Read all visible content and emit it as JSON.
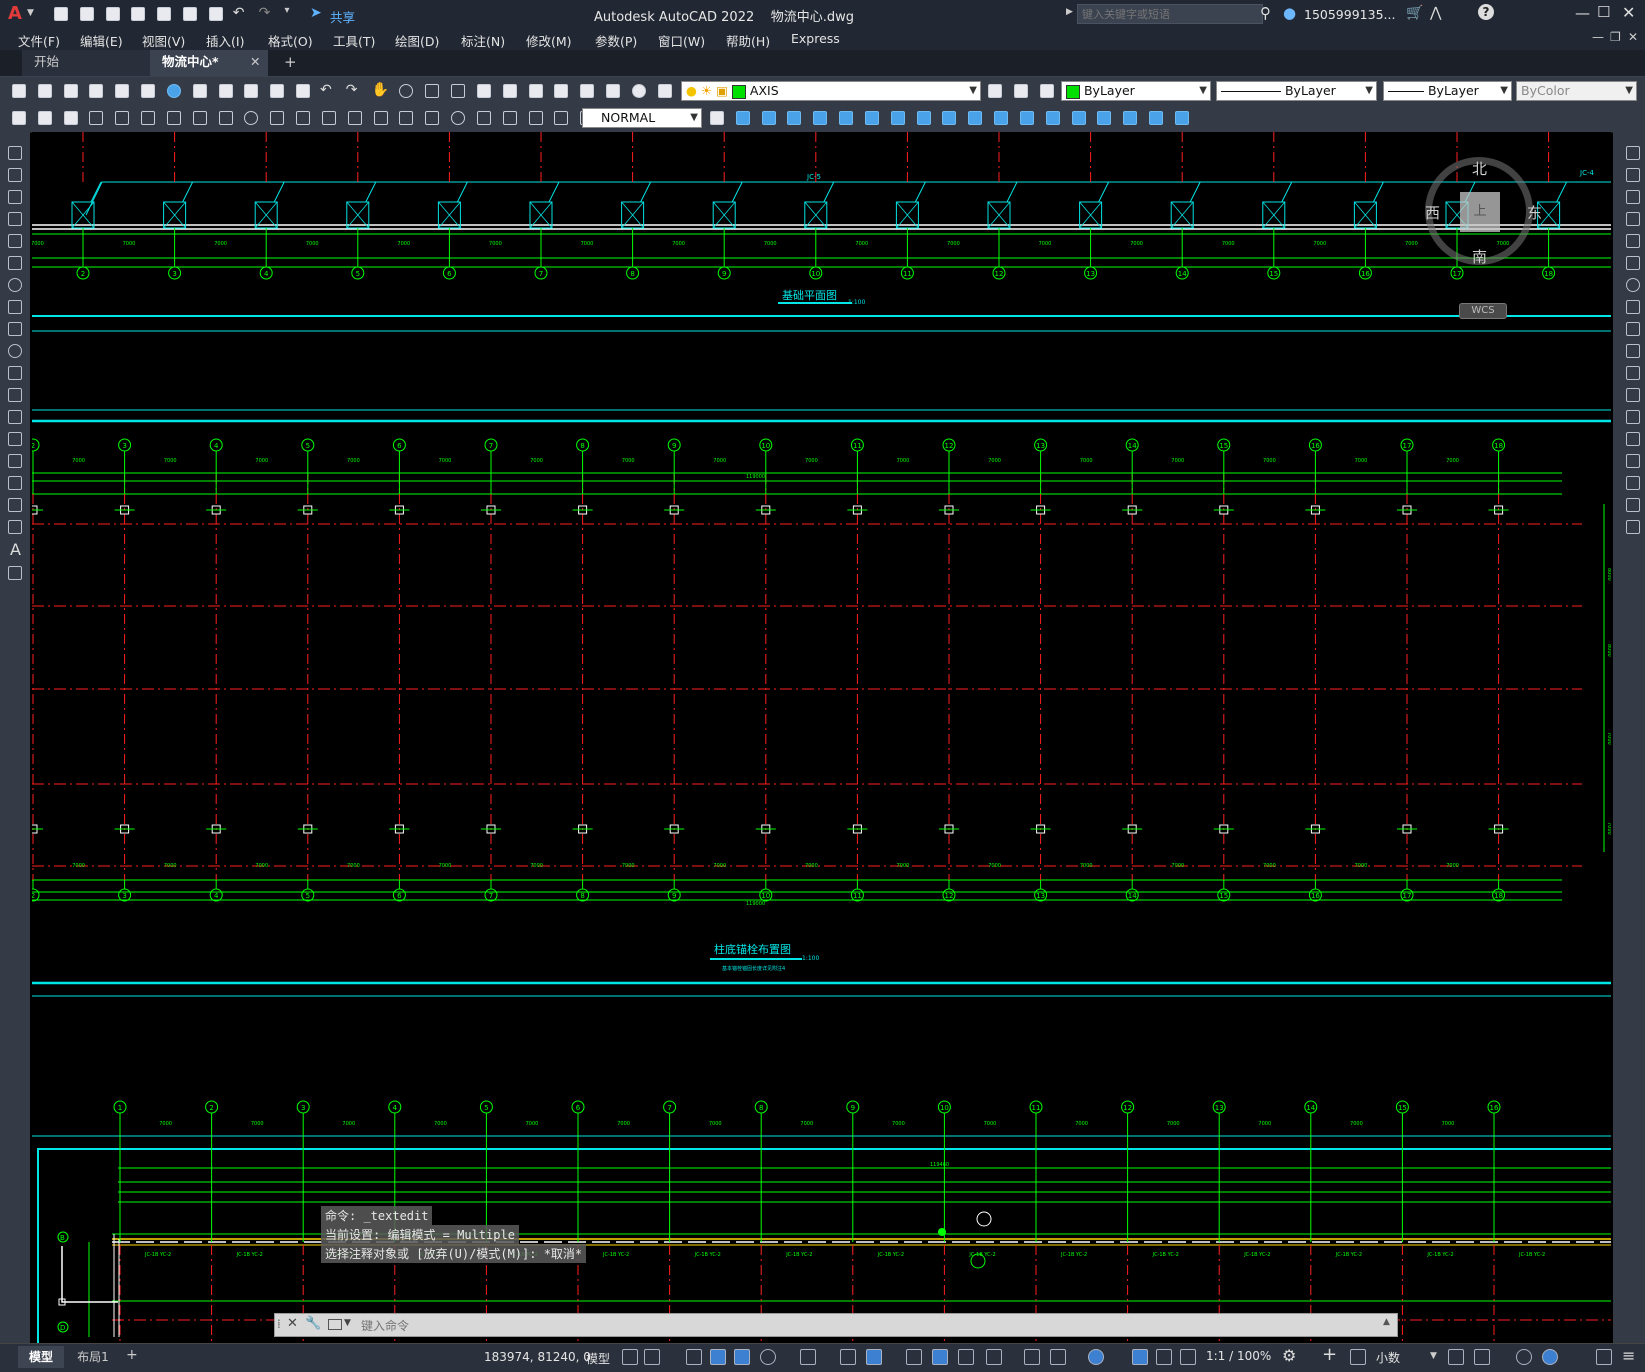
{
  "titlebar": {
    "app_logo": "A",
    "share_label": "共享",
    "title": "Autodesk AutoCAD 2022    物流中心.dwg",
    "search_placeholder": "键入关键字或短语",
    "user": "1505999135...",
    "min_icon": "minimize-icon",
    "max_icon": "maximize-icon",
    "close_icon": "close-icon"
  },
  "menubar": {
    "items": [
      "文件(F)",
      "编辑(E)",
      "视图(V)",
      "插入(I)",
      "格式(O)",
      "工具(T)",
      "绘图(D)",
      "标注(N)",
      "修改(M)",
      "参数(P)",
      "窗口(W)",
      "帮助(H)",
      "Express"
    ]
  },
  "tabs": {
    "start": "开始",
    "active": "物流中心*",
    "add": "+"
  },
  "toolbar1": {
    "layer_value": "AXIS",
    "color_value": "ByLayer",
    "linetype_value": "ByLayer",
    "lineweight_value": "ByLayer",
    "plotstyle_value": "ByColor"
  },
  "toolbar2": {
    "dimstyle_value": "NORMAL"
  },
  "viewcube": {
    "north": "北",
    "south": "南",
    "east": "东",
    "west": "西",
    "top": "上",
    "wcs": "WCS"
  },
  "drawing": {
    "plan1": {
      "title": "基础平面图",
      "scale": "1:100",
      "axis_labels": [
        "2",
        "3",
        "4",
        "5",
        "6",
        "7",
        "8",
        "9",
        "10",
        "11",
        "12",
        "13",
        "14",
        "15",
        "16",
        "17",
        "18"
      ],
      "dim_text": "7000",
      "total_text": "119000",
      "tag1": "JC-5",
      "tag2": "JC-4"
    },
    "plan2": {
      "title": "柱底锚栓布置图",
      "scale": "1:100",
      "subtitle": "基本锚栓锚固长度详见附注4",
      "axis_labels": [
        "2",
        "3",
        "4",
        "5",
        "6",
        "7",
        "8",
        "9",
        "10",
        "11",
        "12",
        "13",
        "14",
        "15",
        "16",
        "17",
        "18"
      ],
      "dim_text": "7000",
      "total_text": "119000",
      "side_dims": [
        "8000",
        "8000",
        "7000",
        "7000"
      ]
    },
    "plan3": {
      "axis_labels": [
        "1",
        "2",
        "3",
        "4",
        "5",
        "6",
        "7",
        "8",
        "9",
        "10",
        "11",
        "12",
        "13",
        "14",
        "15",
        "16"
      ],
      "total_text": "119460",
      "dim_text": "7000",
      "side_label_b": "B",
      "side_label_d": "D",
      "beam_label": "JC-1B YC-2"
    }
  },
  "commandline": {
    "history": [
      "命令: _textedit",
      "当前设置: 编辑模式 = Multiple",
      "选择注释对象或 [放弃(U)/模式(M)]: *取消*"
    ],
    "placeholder": "键入命令"
  },
  "statusbar": {
    "tab_model": "模型",
    "tab_layout": "布局1",
    "add": "+",
    "coords": "183974, 81240, 0",
    "space": "模型",
    "scale": "1:1 / 100%",
    "units": "小数"
  },
  "colors": {
    "cyan": "#00e5e5",
    "green": "#00ff00",
    "red": "#ff2020",
    "white": "#ffffff",
    "yellow": "#ffd700"
  }
}
